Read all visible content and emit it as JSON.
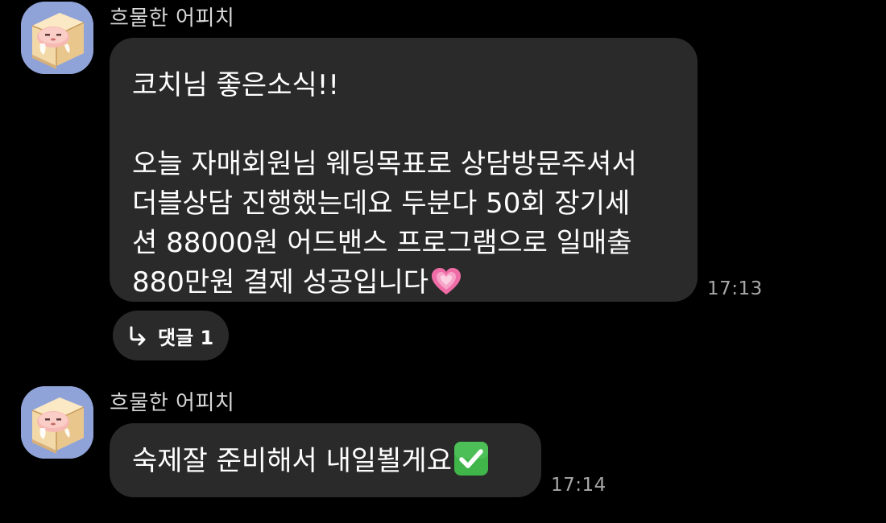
{
  "messages": [
    {
      "sender": "흐물한 어피치",
      "lines": [
        "코치님 좋은소식!!",
        "",
        "오늘 자매회원님 웨딩목표로 상담방문주셔서",
        "더블상담 진행했는데요 두분다 50회 장기세",
        "션 88000원 어드밴스 프로그램으로 일매출",
        "880만원 결제 성공입니다"
      ],
      "emoji": "heart-emoji",
      "time": "17:13",
      "reply": {
        "label": "댓글 1",
        "icon": "reply-arrow-icon"
      }
    },
    {
      "sender": "흐물한 어피치",
      "lines": [
        "숙제잘 준비해서 내일뵐게요"
      ],
      "emoji": "check-mark-emoji",
      "time": "17:14"
    }
  ],
  "colors": {
    "background": "#000000",
    "bubble": "#2a2a2a",
    "text": "#ffffff",
    "sender": "#d8d8d8",
    "time": "#a8a8a8",
    "avatar_bg": "#8fa3d8"
  }
}
